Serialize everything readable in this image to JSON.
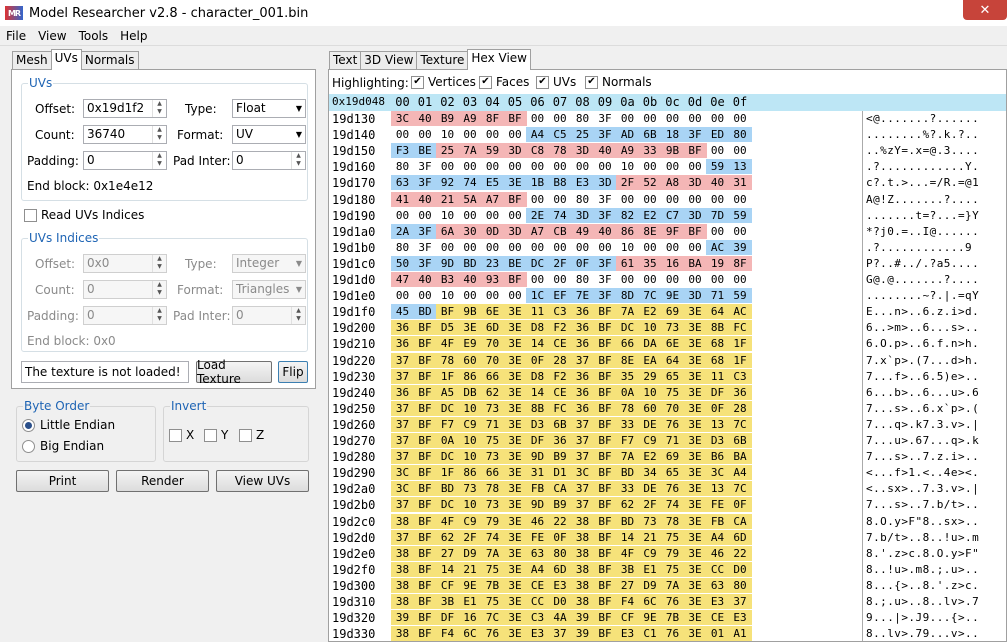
{
  "window": {
    "title": "Model Researcher v2.8 - character_001.bin",
    "logo": "MR",
    "close_glyph": "✕"
  },
  "menu": [
    "File",
    "View",
    "Tools",
    "Help"
  ],
  "left_tabs": [
    {
      "label": "Mesh"
    },
    {
      "label": "UVs"
    },
    {
      "label": "Normals"
    }
  ],
  "right_tabs": [
    {
      "label": "Text"
    },
    {
      "label": "3D View"
    },
    {
      "label": "Texture"
    },
    {
      "label": "Hex View"
    }
  ],
  "uvs_group": {
    "title": "UVs",
    "offset_label": "Offset:",
    "offset_value": "0x19d1f2",
    "count_label": "Count:",
    "count_value": "36740",
    "padding_label": "Padding:",
    "padding_value": "0",
    "type_label": "Type:",
    "type_value": "Float",
    "format_label": "Format:",
    "format_value": "UV",
    "pad_inter_label": "Pad Inter:",
    "pad_inter_value": "0",
    "end_block": "End block: 0x1e4e12"
  },
  "read_indices": {
    "label": "Read UVs Indices",
    "checked": false
  },
  "indices_group": {
    "title": "UVs Indices",
    "offset_label": "Offset:",
    "offset_value": "0x0",
    "count_label": "Count:",
    "count_value": "0",
    "padding_label": "Padding:",
    "padding_value": "0",
    "type_label": "Type:",
    "type_value": "Integer",
    "format_label": "Format:",
    "format_value": "Triangles",
    "pad_inter_label": "Pad Inter:",
    "pad_inter_value": "0",
    "end_block": "End block: 0x0"
  },
  "texture": {
    "status": "The texture is not loaded!",
    "load_label": "Load Texture",
    "flip_label": "Flip"
  },
  "byte_order": {
    "title": "Byte Order",
    "little": "Little Endian",
    "big": "Big Endian",
    "selected": "little"
  },
  "invert": {
    "title": "Invert",
    "x": "X",
    "y": "Y",
    "z": "Z"
  },
  "actions": {
    "print": "Print",
    "render": "Render",
    "view_uvs": "View UVs"
  },
  "highlighting": {
    "label": "Highlighting:",
    "check_glyph": "✔",
    "options": [
      {
        "label": "Vertices",
        "checked": true
      },
      {
        "label": "Faces",
        "checked": true
      },
      {
        "label": "UVs",
        "checked": true
      },
      {
        "label": "Normals",
        "checked": true
      }
    ]
  },
  "hex": {
    "base": "0x19d048",
    "columns": [
      "00",
      "01",
      "02",
      "03",
      "04",
      "05",
      "06",
      "07",
      "08",
      "09",
      "0a",
      "0b",
      "0c",
      "0d",
      "0e",
      "0f"
    ],
    "rows": [
      {
        "addr": "19d130",
        "bytes": [
          "3C",
          "40",
          "B9",
          "A9",
          "8F",
          "BF",
          "00",
          "00",
          "80",
          "3F",
          "00",
          "00",
          "00",
          "00",
          "00",
          "00"
        ],
        "hl": "rrrrrr..........",
        "ascii": "<@.......?......"
      },
      {
        "addr": "19d140",
        "bytes": [
          "00",
          "00",
          "10",
          "00",
          "00",
          "00",
          "A4",
          "C5",
          "25",
          "3F",
          "AD",
          "6B",
          "18",
          "3F",
          "ED",
          "80"
        ],
        "hl": "......bbbbbbbbbb",
        "ascii": "........%?.k.?.."
      },
      {
        "addr": "19d150",
        "bytes": [
          "F3",
          "BE",
          "25",
          "7A",
          "59",
          "3D",
          "C8",
          "78",
          "3D",
          "40",
          "A9",
          "33",
          "9B",
          "BF",
          "00",
          "00"
        ],
        "hl": "bbrrrrrrrrrrrr..",
        "ascii": "..%zY=.x=@.3...."
      },
      {
        "addr": "19d160",
        "bytes": [
          "80",
          "3F",
          "00",
          "00",
          "00",
          "00",
          "00",
          "00",
          "00",
          "00",
          "10",
          "00",
          "00",
          "00",
          "59",
          "13"
        ],
        "hl": "..............bb",
        "ascii": ".?............Y."
      },
      {
        "addr": "19d170",
        "bytes": [
          "63",
          "3F",
          "92",
          "74",
          "E5",
          "3E",
          "1B",
          "B8",
          "E3",
          "3D",
          "2F",
          "52",
          "A8",
          "3D",
          "40",
          "31"
        ],
        "hl": "bbbbbbbbbbrrrrrr",
        "ascii": "c?.t.>...=/R.=@1"
      },
      {
        "addr": "19d180",
        "bytes": [
          "41",
          "40",
          "21",
          "5A",
          "A7",
          "BF",
          "00",
          "00",
          "80",
          "3F",
          "00",
          "00",
          "00",
          "00",
          "00",
          "00"
        ],
        "hl": "rrrrrr..........",
        "ascii": "A@!Z.......?...."
      },
      {
        "addr": "19d190",
        "bytes": [
          "00",
          "00",
          "10",
          "00",
          "00",
          "00",
          "2E",
          "74",
          "3D",
          "3F",
          "82",
          "E2",
          "C7",
          "3D",
          "7D",
          "59"
        ],
        "hl": "......bbbbbbbbbb",
        "ascii": ".......t=?...=}Y"
      },
      {
        "addr": "19d1a0",
        "bytes": [
          "2A",
          "3F",
          "6A",
          "30",
          "0D",
          "3D",
          "A7",
          "CB",
          "49",
          "40",
          "86",
          "8E",
          "9F",
          "BF",
          "00",
          "00"
        ],
        "hl": "bbrrrrrrrrrrrr..",
        "ascii": "*?j0.=..I@......"
      },
      {
        "addr": "19d1b0",
        "bytes": [
          "80",
          "3F",
          "00",
          "00",
          "00",
          "00",
          "00",
          "00",
          "00",
          "00",
          "10",
          "00",
          "00",
          "00",
          "AC",
          "39"
        ],
        "hl": "..............bb",
        "ascii": ".?............9"
      },
      {
        "addr": "19d1c0",
        "bytes": [
          "50",
          "3F",
          "9D",
          "BD",
          "23",
          "BE",
          "DC",
          "2F",
          "0F",
          "3F",
          "61",
          "35",
          "16",
          "BA",
          "19",
          "8F"
        ],
        "hl": "bbbbbbbbbbrrrrrr",
        "ascii": "P?..#../.?a5...."
      },
      {
        "addr": "19d1d0",
        "bytes": [
          "47",
          "40",
          "B3",
          "40",
          "93",
          "BF",
          "00",
          "00",
          "80",
          "3F",
          "00",
          "00",
          "00",
          "00",
          "00",
          "00"
        ],
        "hl": "rrrrrr..........",
        "ascii": "G@.@.......?...."
      },
      {
        "addr": "19d1e0",
        "bytes": [
          "00",
          "00",
          "10",
          "00",
          "00",
          "00",
          "1C",
          "EF",
          "7E",
          "3F",
          "8D",
          "7C",
          "9E",
          "3D",
          "71",
          "59"
        ],
        "hl": "......bbbbbbbbbb",
        "ascii": "........~?.|.=qY"
      },
      {
        "addr": "19d1f0",
        "bytes": [
          "45",
          "BD",
          "BF",
          "9B",
          "6E",
          "3E",
          "11",
          "C3",
          "36",
          "BF",
          "7A",
          "E2",
          "69",
          "3E",
          "64",
          "AC"
        ],
        "hl": "bbyyyyyyyyyyyyyy",
        "ascii": "E...n>..6.z.i>d."
      },
      {
        "addr": "19d200",
        "bytes": [
          "36",
          "BF",
          "D5",
          "3E",
          "6D",
          "3E",
          "D8",
          "F2",
          "36",
          "BF",
          "DC",
          "10",
          "73",
          "3E",
          "8B",
          "FC"
        ],
        "hl": "yyyyyyyyyyyyyyyy",
        "ascii": "6..>m>..6...s>.."
      },
      {
        "addr": "19d210",
        "bytes": [
          "36",
          "BF",
          "4F",
          "E9",
          "70",
          "3E",
          "14",
          "CE",
          "36",
          "BF",
          "66",
          "DA",
          "6E",
          "3E",
          "68",
          "1F"
        ],
        "hl": "yyyyyyyyyyyyyyyy",
        "ascii": "6.O.p>..6.f.n>h."
      },
      {
        "addr": "19d220",
        "bytes": [
          "37",
          "BF",
          "78",
          "60",
          "70",
          "3E",
          "0F",
          "28",
          "37",
          "BF",
          "8E",
          "EA",
          "64",
          "3E",
          "68",
          "1F"
        ],
        "hl": "yyyyyyyyyyyyyyyy",
        "ascii": "7.x`p>.(7...d>h."
      },
      {
        "addr": "19d230",
        "bytes": [
          "37",
          "BF",
          "1F",
          "86",
          "66",
          "3E",
          "D8",
          "F2",
          "36",
          "BF",
          "35",
          "29",
          "65",
          "3E",
          "11",
          "C3"
        ],
        "hl": "yyyyyyyyyyyyyyyy",
        "ascii": "7...f>..6.5)e>.."
      },
      {
        "addr": "19d240",
        "bytes": [
          "36",
          "BF",
          "A5",
          "DB",
          "62",
          "3E",
          "14",
          "CE",
          "36",
          "BF",
          "0A",
          "10",
          "75",
          "3E",
          "DF",
          "36"
        ],
        "hl": "yyyyyyyyyyyyyyyy",
        "ascii": "6...b>..6...u>.6"
      },
      {
        "addr": "19d250",
        "bytes": [
          "37",
          "BF",
          "DC",
          "10",
          "73",
          "3E",
          "8B",
          "FC",
          "36",
          "BF",
          "78",
          "60",
          "70",
          "3E",
          "0F",
          "28"
        ],
        "hl": "yyyyyyyyyyyyyyyy",
        "ascii": "7...s>..6.x`p>.("
      },
      {
        "addr": "19d260",
        "bytes": [
          "37",
          "BF",
          "F7",
          "C9",
          "71",
          "3E",
          "D3",
          "6B",
          "37",
          "BF",
          "33",
          "DE",
          "76",
          "3E",
          "13",
          "7C"
        ],
        "hl": "yyyyyyyyyyyyyyyy",
        "ascii": "7...q>.k7.3.v>.|"
      },
      {
        "addr": "19d270",
        "bytes": [
          "37",
          "BF",
          "0A",
          "10",
          "75",
          "3E",
          "DF",
          "36",
          "37",
          "BF",
          "F7",
          "C9",
          "71",
          "3E",
          "D3",
          "6B"
        ],
        "hl": "yyyyyyyyyyyyyyyy",
        "ascii": "7...u>.67...q>.k"
      },
      {
        "addr": "19d280",
        "bytes": [
          "37",
          "BF",
          "DC",
          "10",
          "73",
          "3E",
          "9D",
          "B9",
          "37",
          "BF",
          "7A",
          "E2",
          "69",
          "3E",
          "B6",
          "BA"
        ],
        "hl": "yyyyyyyyyyyyyyyy",
        "ascii": "7...s>..7.z.i>.."
      },
      {
        "addr": "19d290",
        "bytes": [
          "3C",
          "BF",
          "1F",
          "86",
          "66",
          "3E",
          "31",
          "D1",
          "3C",
          "BF",
          "BD",
          "34",
          "65",
          "3E",
          "3C",
          "A4"
        ],
        "hl": "yyyyyyyyyyyyyyyy",
        "ascii": "<...f>1.<..4e><."
      },
      {
        "addr": "19d2a0",
        "bytes": [
          "3C",
          "BF",
          "BD",
          "73",
          "78",
          "3E",
          "FB",
          "CA",
          "37",
          "BF",
          "33",
          "DE",
          "76",
          "3E",
          "13",
          "7C"
        ],
        "hl": "yyyyyyyyyyyyyyyy",
        "ascii": "<..sx>..7.3.v>.|"
      },
      {
        "addr": "19d2b0",
        "bytes": [
          "37",
          "BF",
          "DC",
          "10",
          "73",
          "3E",
          "9D",
          "B9",
          "37",
          "BF",
          "62",
          "2F",
          "74",
          "3E",
          "FE",
          "0F"
        ],
        "hl": "yyyyyyyyyyyyyyyy",
        "ascii": "7...s>..7.b/t>.."
      },
      {
        "addr": "19d2c0",
        "bytes": [
          "38",
          "BF",
          "4F",
          "C9",
          "79",
          "3E",
          "46",
          "22",
          "38",
          "BF",
          "BD",
          "73",
          "78",
          "3E",
          "FB",
          "CA"
        ],
        "hl": "yyyyyyyyyyyyyyyy",
        "ascii": "8.O.y>F\"8..sx>.."
      },
      {
        "addr": "19d2d0",
        "bytes": [
          "37",
          "BF",
          "62",
          "2F",
          "74",
          "3E",
          "FE",
          "0F",
          "38",
          "BF",
          "14",
          "21",
          "75",
          "3E",
          "A4",
          "6D"
        ],
        "hl": "yyyyyyyyyyyyyyyy",
        "ascii": "7.b/t>..8..!u>.m"
      },
      {
        "addr": "19d2e0",
        "bytes": [
          "38",
          "BF",
          "27",
          "D9",
          "7A",
          "3E",
          "63",
          "80",
          "38",
          "BF",
          "4F",
          "C9",
          "79",
          "3E",
          "46",
          "22"
        ],
        "hl": "yyyyyyyyyyyyyyyy",
        "ascii": "8.'.z>c.8.O.y>F\""
      },
      {
        "addr": "19d2f0",
        "bytes": [
          "38",
          "BF",
          "14",
          "21",
          "75",
          "3E",
          "A4",
          "6D",
          "38",
          "BF",
          "3B",
          "E1",
          "75",
          "3E",
          "CC",
          "D0"
        ],
        "hl": "yyyyyyyyyyyyyyyy",
        "ascii": "8..!u>.m8.;.u>.."
      },
      {
        "addr": "19d300",
        "bytes": [
          "38",
          "BF",
          "CF",
          "9E",
          "7B",
          "3E",
          "CE",
          "E3",
          "38",
          "BF",
          "27",
          "D9",
          "7A",
          "3E",
          "63",
          "80"
        ],
        "hl": "yyyyyyyyyyyyyyyy",
        "ascii": "8...{>..8.'.z>c."
      },
      {
        "addr": "19d310",
        "bytes": [
          "38",
          "BF",
          "3B",
          "E1",
          "75",
          "3E",
          "CC",
          "D0",
          "38",
          "BF",
          "F4",
          "6C",
          "76",
          "3E",
          "E3",
          "37"
        ],
        "hl": "yyyyyyyyyyyyyyyy",
        "ascii": "8.;.u>..8..lv>.7"
      },
      {
        "addr": "19d320",
        "bytes": [
          "39",
          "BF",
          "DF",
          "16",
          "7C",
          "3E",
          "C3",
          "4A",
          "39",
          "BF",
          "CF",
          "9E",
          "7B",
          "3E",
          "CE",
          "E3"
        ],
        "hl": "yyyyyyyyyyyyyyyy",
        "ascii": "9...|>.J9...{>.."
      },
      {
        "addr": "19d330",
        "bytes": [
          "38",
          "BF",
          "F4",
          "6C",
          "76",
          "3E",
          "E3",
          "37",
          "39",
          "BF",
          "E3",
          "C1",
          "76",
          "3E",
          "01",
          "A1"
        ],
        "hl": "yyyyyyyyyyyyyyyy",
        "ascii": "8..lv>.79...v>.."
      }
    ]
  }
}
